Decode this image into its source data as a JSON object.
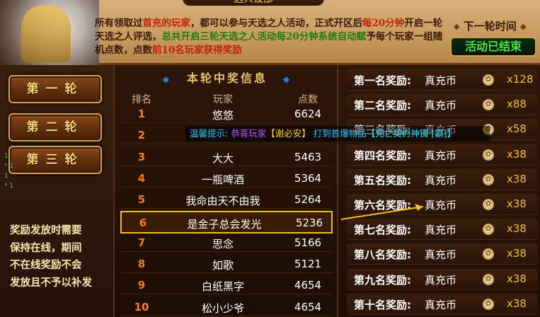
{
  "header": {
    "title": "选人设部",
    "intro_parts": [
      {
        "t": "所有领取过",
        "c": ""
      },
      {
        "t": "首充的玩家",
        "c": "red"
      },
      {
        "t": "，都可以参与天选之人活动，正式开区后",
        "c": ""
      },
      {
        "t": "每20分钟",
        "c": "red"
      },
      {
        "t": "开启一轮天选之人评选，",
        "c": ""
      },
      {
        "t": "总共开启三轮天选之人活动每20分钟系统自动赋",
        "c": "green"
      },
      {
        "t": "予每个玩家一组随机点数，点数",
        "c": ""
      },
      {
        "t": "前10名玩家获得奖励",
        "c": "red"
      }
    ],
    "next_round_label": "下一轮时间",
    "status_button": "活动已结束"
  },
  "rounds": [
    "第一轮",
    "第二轮",
    "第三轮"
  ],
  "notice": [
    "奖励发放时需要",
    "保持在线，期间",
    "不在线奖励不会",
    "发放且不予以补发"
  ],
  "side_log": [
    "1",
    "* 1",
    "1",
    "* 1"
  ],
  "ranking": {
    "title": "本轮中奖信息",
    "headers": [
      "排名",
      "玩家",
      "点数"
    ],
    "rows": [
      {
        "rank": "1",
        "name": "悠悠",
        "points": "6624"
      },
      {
        "rank": "2",
        "name": "",
        "points": ""
      },
      {
        "rank": "3",
        "name": "大大",
        "points": "5463"
      },
      {
        "rank": "4",
        "name": "一瓶啤酒",
        "points": "5364"
      },
      {
        "rank": "5",
        "name": "我命由天不由我",
        "points": "5264"
      },
      {
        "rank": "6",
        "name": "是金子总会发光",
        "points": "5236"
      },
      {
        "rank": "7",
        "name": "思念",
        "points": "5166"
      },
      {
        "rank": "8",
        "name": "如歌",
        "points": "5121"
      },
      {
        "rank": "9",
        "name": "白纸黑字",
        "points": "4654"
      },
      {
        "rank": "10",
        "name": "松小少爷",
        "points": "4654"
      }
    ],
    "highlighted_rank": "6"
  },
  "rewards": [
    {
      "label": "第一名奖励:",
      "item": "真充币",
      "qty": "x128"
    },
    {
      "label": "第二名奖励:",
      "item": "真充币",
      "qty": "x88"
    },
    {
      "label": "第三名奖励:",
      "item": "真充币",
      "qty": "x58"
    },
    {
      "label": "第四名奖励:",
      "item": "真充币",
      "qty": "x38"
    },
    {
      "label": "第五名奖励:",
      "item": "真充币",
      "qty": "x38"
    },
    {
      "label": "第六名奖励:",
      "item": "真充币",
      "qty": "x38"
    },
    {
      "label": "第七名奖励:",
      "item": "真充币",
      "qty": "x38"
    },
    {
      "label": "第八名奖励:",
      "item": "真充币",
      "qty": "x38"
    },
    {
      "label": "第九名奖励:",
      "item": "真充币",
      "qty": "x38"
    },
    {
      "label": "第十名奖励:",
      "item": "真充币",
      "qty": "x38"
    }
  ],
  "toast": {
    "prefix": "温馨提示:",
    "msg1": "恭喜玩家",
    "player": "【谢必安】",
    "msg2": "打到首爆物品",
    "item": "【死亡契约神镯·[霸]】"
  },
  "colors": {
    "accent": "#f0c11e",
    "ended_green": "#49e34a",
    "rank_orange": "#ff7a1a"
  }
}
